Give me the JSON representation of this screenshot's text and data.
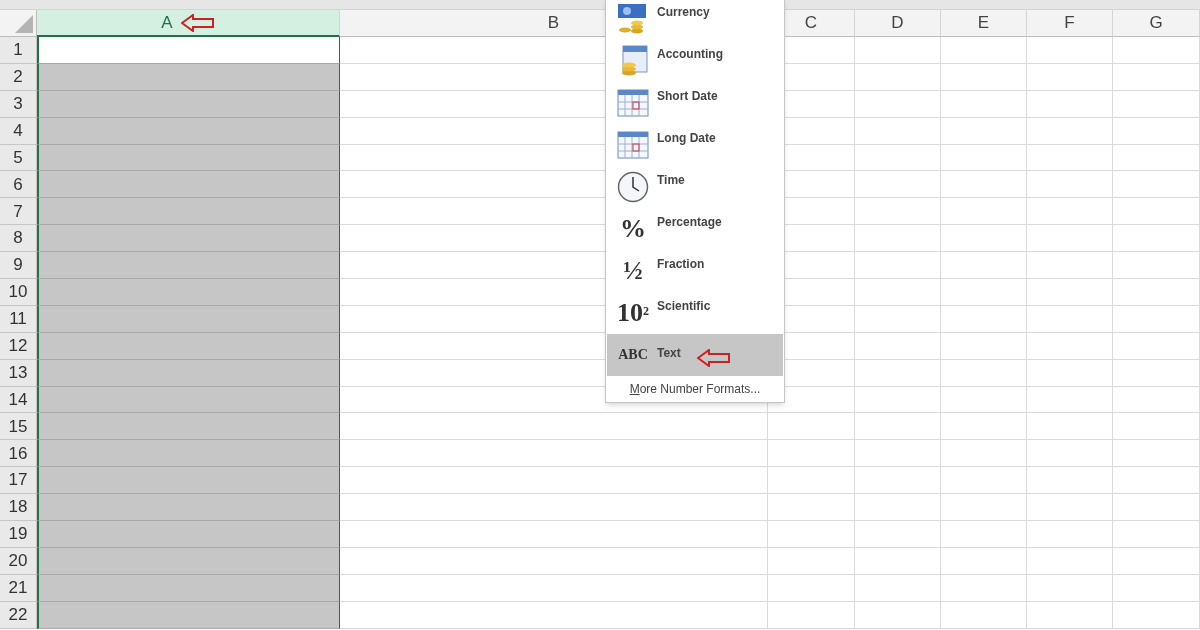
{
  "sheet": {
    "columns": [
      {
        "label": "A",
        "selected": true
      },
      {
        "label": "B",
        "selected": false
      },
      {
        "label": "C",
        "selected": false
      },
      {
        "label": "D",
        "selected": false
      },
      {
        "label": "E",
        "selected": false
      },
      {
        "label": "F",
        "selected": false
      },
      {
        "label": "G",
        "selected": false
      }
    ],
    "rows": [
      "1",
      "2",
      "3",
      "4",
      "5",
      "6",
      "7",
      "8",
      "9",
      "10",
      "11",
      "12",
      "13",
      "14",
      "15",
      "16",
      "17",
      "18",
      "19",
      "20",
      "21",
      "22"
    ]
  },
  "format_menu": {
    "items": [
      {
        "label": "Currency",
        "kind": "currency",
        "selected": false
      },
      {
        "label": "Accounting",
        "kind": "accounting",
        "selected": false
      },
      {
        "label": "Short Date",
        "kind": "date",
        "selected": false
      },
      {
        "label": "Long Date",
        "kind": "date",
        "selected": false
      },
      {
        "label": "Time",
        "kind": "time",
        "selected": false
      },
      {
        "label": "Percentage",
        "kind": "glyph",
        "glyph": "%",
        "selected": false
      },
      {
        "label": "Fraction",
        "kind": "glyph",
        "glyph": "½",
        "selected": false
      },
      {
        "label": "Scientific",
        "kind": "glyph",
        "glyph": "10$^{2}$",
        "selected": false
      },
      {
        "label": "Text",
        "kind": "letters",
        "glyph": "ABC",
        "selected": true
      }
    ],
    "footer": "More Number Formats..."
  }
}
